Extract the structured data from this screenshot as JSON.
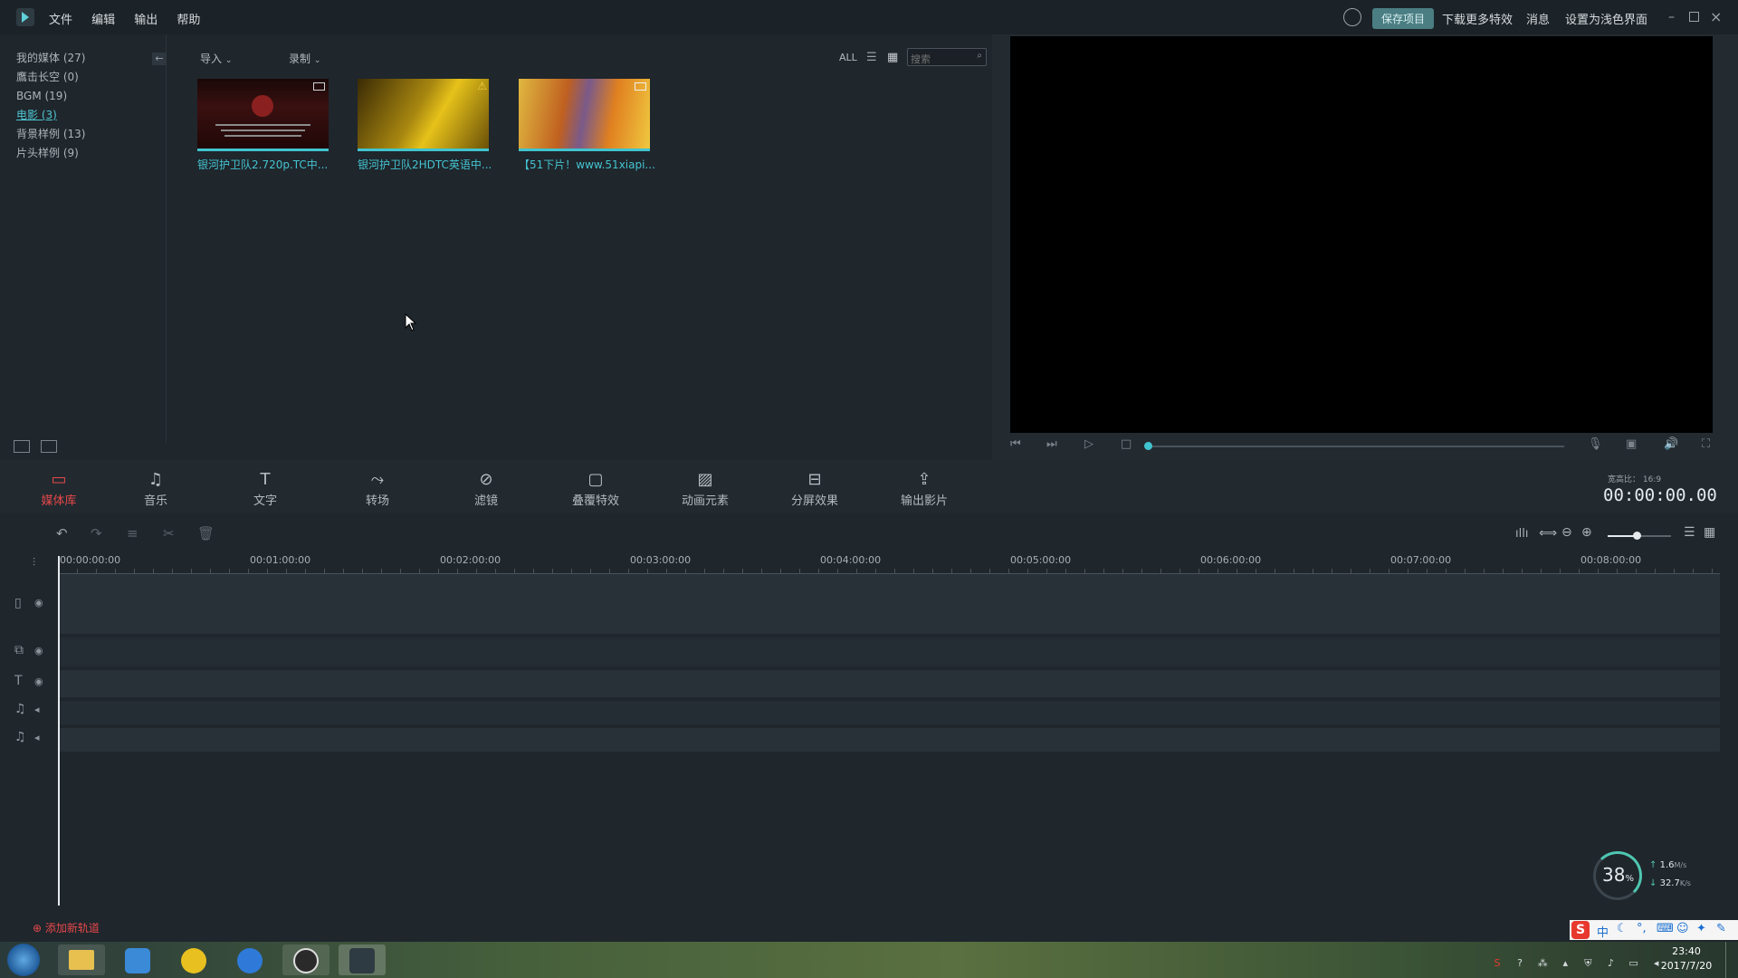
{
  "menu": {
    "file": "文件",
    "edit": "编辑",
    "export": "输出",
    "help": "帮助"
  },
  "topbar": {
    "save_label": "保存项目",
    "download_effects": "下载更多特效",
    "messages": "消息",
    "light_theme": "设置为浅色界面"
  },
  "sidebar": {
    "items": [
      {
        "label": "我的媒体 (27)"
      },
      {
        "label": "鷹击长空 (0)"
      },
      {
        "label": "BGM (19)"
      },
      {
        "label": "电影 (3)"
      },
      {
        "label": "背景样例 (13)"
      },
      {
        "label": "片头样例 (9)"
      }
    ]
  },
  "media": {
    "import_label": "导入",
    "record_label": "录制",
    "filter_all": "ALL",
    "search_placeholder": "搜索",
    "thumbs": [
      {
        "label": "银河护卫队2.720p.TC中..."
      },
      {
        "label": "银河护卫队2HDTC英语中..."
      },
      {
        "label": "【51下片！www.51xiapi..."
      }
    ]
  },
  "toolbar": {
    "items": [
      {
        "label": "媒体库"
      },
      {
        "label": "音乐"
      },
      {
        "label": "文字"
      },
      {
        "label": "转场"
      },
      {
        "label": "滤镜"
      },
      {
        "label": "叠覆特效"
      },
      {
        "label": "动画元素"
      },
      {
        "label": "分屏效果"
      },
      {
        "label": "输出影片"
      }
    ],
    "aspect_label": "宽高比： 16:9",
    "timecode": "00:00:00.00"
  },
  "timeline": {
    "ruler": [
      "00:00:00:00",
      "00:01:00:00",
      "00:02:00:00",
      "00:03:00:00",
      "00:04:00:00",
      "00:05:00:00",
      "00:06:00:00",
      "00:07:00:00",
      "00:08:00:00"
    ],
    "add_track": "添加新轨道"
  },
  "netmeter": {
    "percent": "38",
    "percent_unit": "%",
    "up": "1.6",
    "up_unit": "M/s",
    "down": "32.7",
    "down_unit": "K/s"
  },
  "taskbar": {
    "time": "23:40",
    "date": "2017/7/20"
  },
  "ime": {
    "lang": "中"
  },
  "colors": {
    "accent": "#40c4cf",
    "active_tool": "#e6484a",
    "save_bg": "#4a7e83"
  }
}
